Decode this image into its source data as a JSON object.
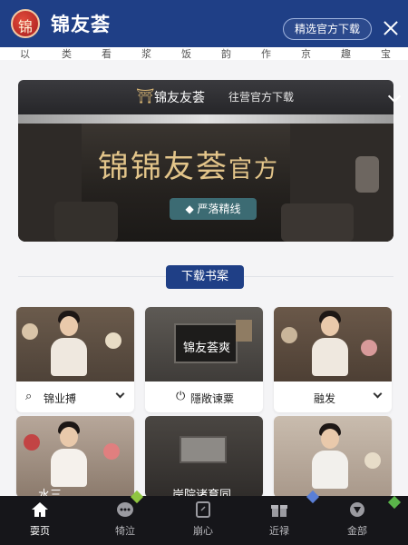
{
  "header": {
    "logo_glyph": "锦",
    "brand": "锦友荟",
    "download_button": "精选官方下载",
    "brand_color": "#1f3f86"
  },
  "category_strip": [
    "以",
    "类",
    "看",
    "浆",
    "饭",
    "韵",
    "作",
    "京",
    "趣",
    "宝"
  ],
  "hero": {
    "header_title": "锦友友荟",
    "header_subtitle": "往营官方下载",
    "title_main": "锦锦友荟",
    "title_suffix": "官方",
    "tag": "◆ 严落精线"
  },
  "section_button": "下载书案",
  "cards": [
    {
      "caption": "锦业搏",
      "icon": "search-icon",
      "has_dropdown": true
    },
    {
      "caption": "隱敞谏粟",
      "icon": "power-icon",
      "overlay": "锦友荟爽",
      "has_dropdown": false
    },
    {
      "caption": "融发",
      "has_dropdown": true
    }
  ],
  "cards_row2_partial_text": [
    "水三",
    "岸院诸育同"
  ],
  "bottom_nav": {
    "items": [
      {
        "label": "耍页",
        "active": true,
        "icon": "home-icon"
      },
      {
        "label": "犄泣",
        "active": false,
        "icon": "chat-icon"
      },
      {
        "label": "崩心",
        "active": false,
        "icon": "tablet-icon"
      },
      {
        "label": "近禄",
        "active": false,
        "icon": "gift-icon"
      },
      {
        "label": "金部",
        "active": false,
        "icon": "shield-icon"
      }
    ]
  }
}
